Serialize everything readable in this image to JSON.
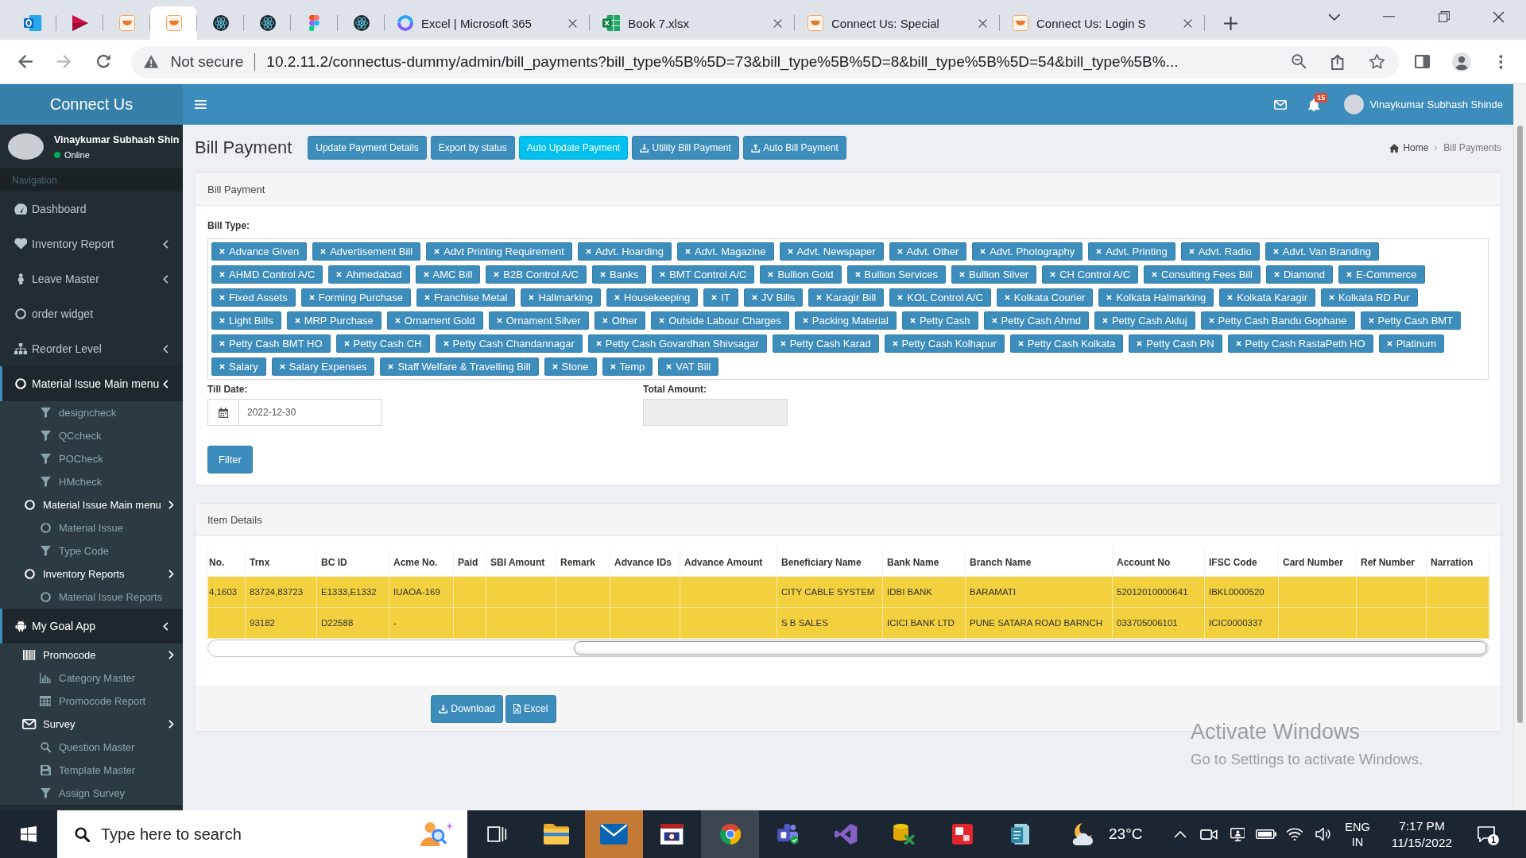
{
  "browser": {
    "tabs": [
      {
        "selected": false
      },
      {
        "selected": false
      },
      {
        "selected": false
      },
      {
        "selected": true
      },
      {
        "selected": false
      },
      {
        "selected": false
      },
      {
        "selected": false
      },
      {
        "selected": false
      },
      {
        "title": "Excel | Microsoft 365",
        "selected": false
      },
      {
        "title": "Book 7.xlsx",
        "selected": false
      },
      {
        "title": "Connect Us: Special",
        "selected": false
      },
      {
        "title": "Connect Us: Login S",
        "selected": false
      }
    ],
    "forward_disabled": true,
    "security_label": "Not secure",
    "url": "10.2.11.2/connectus-dummy/admin/bill_payments?bill_type%5B%5D=73&bill_type%5B%5D=8&bill_type%5B%5D=54&bill_type%5B%..."
  },
  "sidebar": {
    "logo": "Connect Us",
    "user_name": "Vinaykumar Subhash Shin",
    "user_status": "Online",
    "nav_header": "Navigation",
    "menu": [
      {
        "label": "Dashboard",
        "has_submenu": false,
        "active": false
      },
      {
        "label": "Inventory Report",
        "has_submenu": true,
        "active": false
      },
      {
        "label": "Leave Master",
        "has_submenu": true,
        "active": false
      },
      {
        "label": "order widget",
        "has_submenu": false,
        "active": false
      },
      {
        "label": "Reorder Level",
        "has_submenu": true,
        "active": false
      },
      {
        "label": "Material Issue Main menu",
        "has_submenu": true,
        "active": true,
        "children": [
          {
            "label": "designcheck",
            "has_submenu": false,
            "active": false
          },
          {
            "label": "QCcheck",
            "has_submenu": false,
            "active": false
          },
          {
            "label": "POCheck",
            "has_submenu": false,
            "active": false
          },
          {
            "label": "HMcheck",
            "has_submenu": false,
            "active": false
          },
          {
            "label": "Material Issue Main menu",
            "has_submenu": true,
            "active": true,
            "children": [
              {
                "label": "Material Issue",
                "has_submenu": false,
                "active": false
              },
              {
                "label": "Type Code",
                "has_submenu": false,
                "active": false
              }
            ]
          },
          {
            "label": "Inventory Reports",
            "has_submenu": true,
            "active": true,
            "children": [
              {
                "label": "Material Issue Reports",
                "has_submenu": false,
                "active": false
              }
            ]
          }
        ]
      },
      {
        "label": "My Goal App",
        "has_submenu": true,
        "active": true,
        "children": [
          {
            "label": "Promocode",
            "has_submenu": true,
            "active": true,
            "children": [
              {
                "label": "Category Master",
                "has_submenu": false,
                "active": false
              },
              {
                "label": "Promocode Report",
                "has_submenu": false,
                "active": false
              }
            ]
          },
          {
            "label": "Survey",
            "has_submenu": true,
            "active": true,
            "children": [
              {
                "label": "Question Master",
                "has_submenu": false,
                "active": false
              },
              {
                "label": "Template Master",
                "has_submenu": false,
                "active": false
              },
              {
                "label": "Assign Survey",
                "has_submenu": false,
                "active": false
              }
            ]
          }
        ]
      }
    ]
  },
  "header": {
    "notification_count": "15",
    "user_name": "Vinaykumar Subhash Shinde"
  },
  "page": {
    "title": "Bill Payment",
    "actions": [
      {
        "label": "Update Payment Details",
        "kind": "default"
      },
      {
        "label": "Export by status",
        "kind": "default"
      },
      {
        "label": "Auto Update Payment",
        "kind": "info"
      },
      {
        "label": "Utility Bill Payment",
        "kind": "download"
      },
      {
        "label": "Auto Bill Payment",
        "kind": "upload"
      }
    ],
    "breadcrumb": [
      "Home",
      "Bill Payments"
    ]
  },
  "filter_panel": {
    "title": "Bill Payment",
    "bill_type": {
      "label": "Bill Type:",
      "selected": [
        "Advance Given",
        "Advertisement Bill",
        "Advt Printing Requirement",
        "Advt. Hoarding",
        "Advt. Magazine",
        "Advt. Newspaper",
        "Advt. Other",
        "Advt. Photography",
        "Advt. Printing",
        "Advt. Radio",
        "Advt. Van Branding",
        "AHMD Control A/C",
        "Ahmedabad",
        "AMC Bill",
        "B2B Control A/C",
        "Banks",
        "BMT Control A/C",
        "Bullion Gold",
        "Bullion Services",
        "Bullion Silver",
        "CH Control A/C",
        "Consulting Fees Bill",
        "Diamond",
        "E-Commerce",
        "Fixed Assets",
        "Forming Purchase",
        "Franchise Metal",
        "Hallmarking",
        "Housekeeping",
        "IT",
        "JV Bills",
        "Karagir Bill",
        "KOL Control A/C",
        "Kolkata Courier",
        "Kolkata Halmarking",
        "Kolkata Karagir",
        "Kolkata RD Pur",
        "Light Bills",
        "MRP Purchase",
        "Ornament Gold",
        "Ornament Silver",
        "Other",
        "Outside Labour Charges",
        "Packing Material",
        "Petty Cash",
        "Petty Cash Ahmd",
        "Petty Cash Akluj",
        "Petty Cash Bandu Gophane",
        "Petty Cash BMT",
        "Petty Cash BMT HO",
        "Petty Cash CH",
        "Petty Cash Chandannagar",
        "Petty Cash Govardhan Shivsagar",
        "Petty Cash Karad",
        "Petty Cash Kolhapur",
        "Petty Cash Kolkata",
        "Petty Cash PN",
        "Petty Cash RastaPeth HO",
        "Platinum",
        "Salary",
        "Salary Expenses",
        "Staff Welfare & Travelling Bill",
        "Stone",
        "Temp",
        "VAT Bill"
      ]
    },
    "till_date": {
      "label": "Till Date:",
      "value": "2022-12-30"
    },
    "total_amount": {
      "label": "Total Amount:",
      "disabled": true
    },
    "filter_button": "Filter"
  },
  "items_panel": {
    "title": "Item Details",
    "table": {
      "columns": [
        "No.",
        "Trnx",
        "BC ID",
        "Acme No.",
        "Paid",
        "SBI Amount",
        "Remark",
        "Advance IDs",
        "Advance Amount",
        "Beneficiary Name",
        "Bank Name",
        "Branch Name",
        "Account No",
        "IFSC Code",
        "Card Number",
        "Ref Number",
        "Narration"
      ],
      "rows": [
        {
          "highlighted": true,
          "cells": [
            "4,1603",
            "83724,83723",
            "E1333,E1332",
            "IUAOA-169",
            null,
            null,
            null,
            null,
            null,
            "CITY CABLE SYSTEM",
            "IDBI BANK",
            "BARAMATI",
            "52012010000641",
            "IBKL0000520",
            null,
            null,
            null
          ]
        },
        {
          "highlighted": true,
          "cells": [
            null,
            "93182",
            "D22588",
            "-",
            null,
            null,
            null,
            null,
            null,
            "S B SALES",
            "ICICI BANK LTD",
            "PUNE SATARA ROAD BARNCH",
            "033705006101",
            "ICIC0000337",
            null,
            null,
            null
          ]
        }
      ]
    },
    "buttons": [
      {
        "label": "Download",
        "kind": "download"
      },
      {
        "label": "Excel",
        "kind": "file"
      }
    ]
  },
  "os_watermark": {
    "title": "Activate Windows",
    "text": "Go to Settings to activate Windows."
  },
  "taskbar": {
    "search_placeholder": "Type here to search",
    "apps": [
      {
        "selected": false,
        "attention": false
      },
      {
        "selected": false,
        "attention": true
      },
      {
        "selected": false,
        "attention": false
      },
      {
        "selected": true,
        "attention": false
      },
      {
        "selected": false,
        "attention": false
      },
      {
        "selected": false,
        "attention": false
      },
      {
        "selected": false,
        "attention": false
      },
      {
        "selected": false,
        "attention": false
      },
      {
        "selected": false,
        "attention": false
      }
    ],
    "temperature": "23°C",
    "language": "ENG",
    "region": "IN",
    "time": "7:17 PM",
    "date": "11/15/2022",
    "notification_count": "1"
  }
}
